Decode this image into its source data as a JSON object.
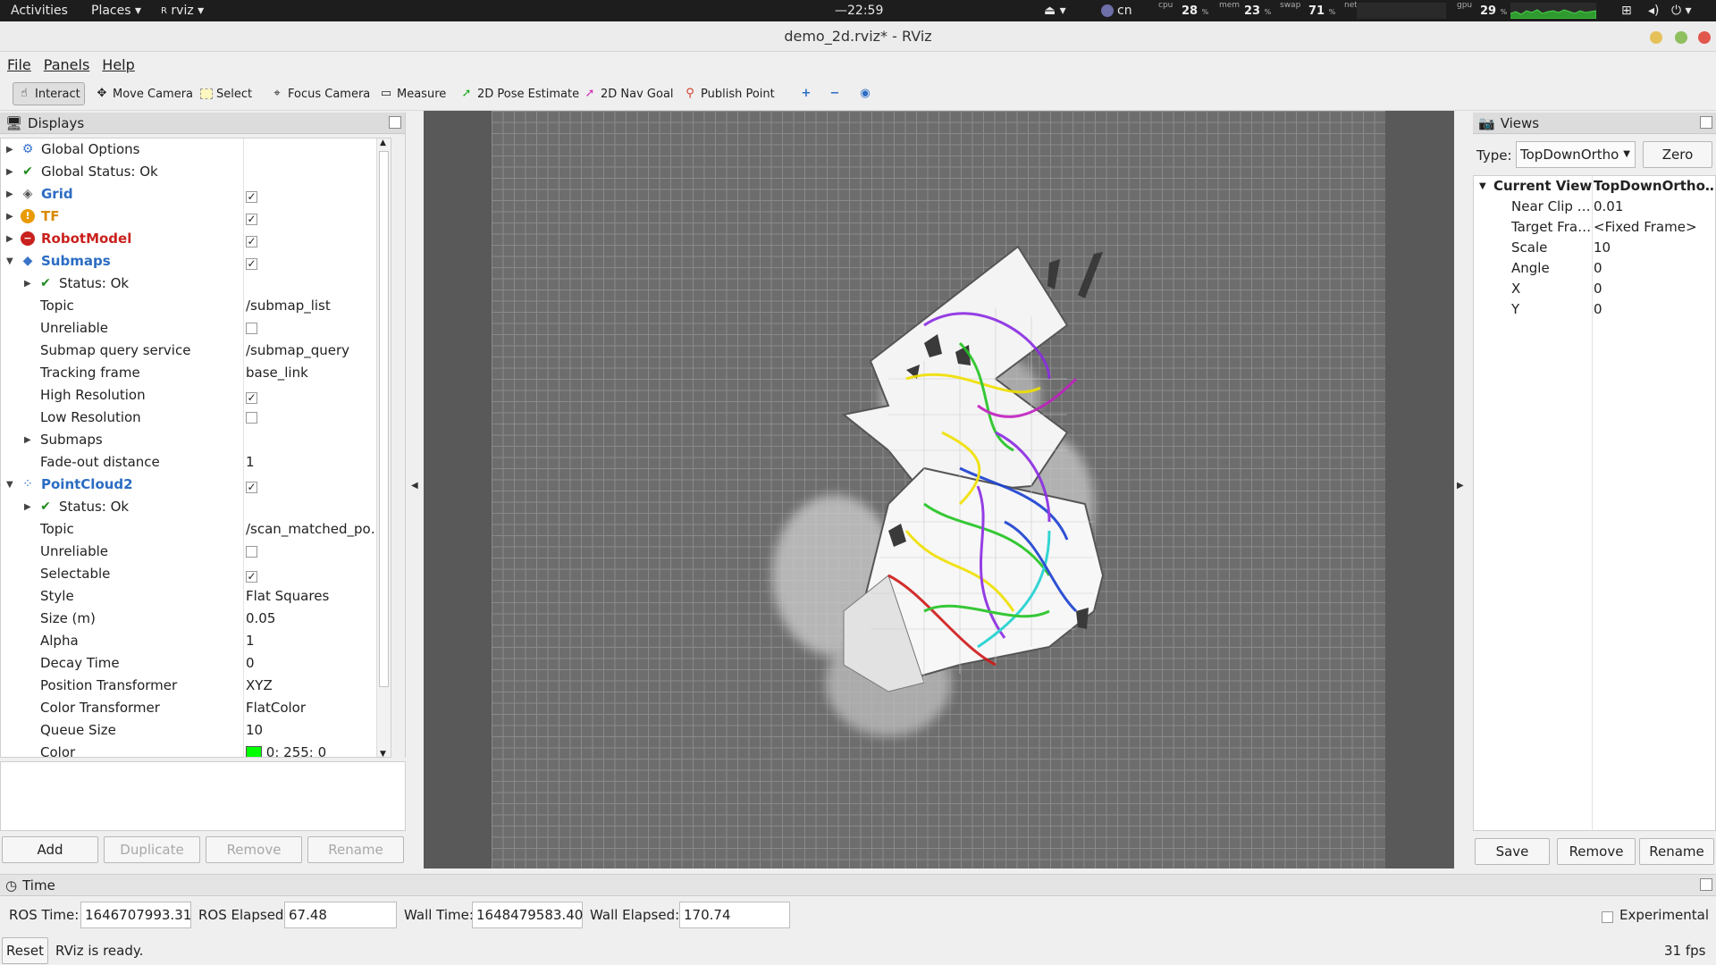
{
  "topbar": {
    "activities": "Activities",
    "places": "Places",
    "app_menu": "rviz",
    "clock": "22:59",
    "keyboard": "cn",
    "cpu_label": "cpu",
    "cpu_value": "28",
    "mem_label": "mem",
    "mem_value": "23",
    "swap_label": "swap",
    "swap_value": "71",
    "net_label": "net",
    "gpu_label": "gpu",
    "gpu_value": "29",
    "pct": "%"
  },
  "window": {
    "title": "demo_2d.rviz* - RViz",
    "close_color": "#e2574c",
    "max_color": "#8fbf5f",
    "min_color": "#e6c15a"
  },
  "menu": {
    "file": "File",
    "panels": "Panels",
    "help": "Help"
  },
  "toolbar": {
    "interact": "Interact",
    "move_camera": "Move Camera",
    "select": "Select",
    "focus_camera": "Focus Camera",
    "measure": "Measure",
    "pose_estimate": "2D Pose Estimate",
    "nav_goal": "2D Nav Goal",
    "publish_point": "Publish Point"
  },
  "displays": {
    "title": "Displays",
    "rows": [
      {
        "label": "Global Options",
        "value": ""
      },
      {
        "label": "Global Status: Ok",
        "value": ""
      },
      {
        "label": "Grid",
        "value": ""
      },
      {
        "label": "TF",
        "value": ""
      },
      {
        "label": "RobotModel",
        "value": ""
      },
      {
        "label": "Submaps",
        "value": ""
      },
      {
        "label": "Status: Ok",
        "value": ""
      },
      {
        "label": "Topic",
        "value": "/submap_list"
      },
      {
        "label": "Unreliable",
        "value": ""
      },
      {
        "label": "Submap query service",
        "value": "/submap_query"
      },
      {
        "label": "Tracking frame",
        "value": "base_link"
      },
      {
        "label": "High Resolution",
        "value": ""
      },
      {
        "label": "Low Resolution",
        "value": ""
      },
      {
        "label": "Submaps",
        "value": ""
      },
      {
        "label": "Fade-out distance",
        "value": "1"
      },
      {
        "label": "PointCloud2",
        "value": ""
      },
      {
        "label": "Status: Ok",
        "value": ""
      },
      {
        "label": "Topic",
        "value": "/scan_matched_poi…"
      },
      {
        "label": "Unreliable",
        "value": ""
      },
      {
        "label": "Selectable",
        "value": ""
      },
      {
        "label": "Style",
        "value": "Flat Squares"
      },
      {
        "label": "Size (m)",
        "value": "0.05"
      },
      {
        "label": "Alpha",
        "value": "1"
      },
      {
        "label": "Decay Time",
        "value": "0"
      },
      {
        "label": "Position Transformer",
        "value": "XYZ"
      },
      {
        "label": "Color Transformer",
        "value": "FlatColor"
      },
      {
        "label": "Queue Size",
        "value": "10"
      },
      {
        "label": "Color",
        "value": "0; 255; 0"
      }
    ],
    "color_swatch": "#00ff00",
    "buttons": {
      "add": "Add",
      "duplicate": "Duplicate",
      "remove": "Remove",
      "rename": "Rename"
    }
  },
  "views": {
    "title": "Views",
    "type_label": "Type:",
    "type_value": "TopDownOrtho",
    "zero": "Zero",
    "current_view": "Current View",
    "current_view_value": "TopDownOrtho…",
    "props": [
      {
        "label": "Near Clip …",
        "value": "0.01"
      },
      {
        "label": "Target Fra…",
        "value": "<Fixed Frame>"
      },
      {
        "label": "Scale",
        "value": "10"
      },
      {
        "label": "Angle",
        "value": "0"
      },
      {
        "label": "X",
        "value": "0"
      },
      {
        "label": "Y",
        "value": "0"
      }
    ],
    "buttons": {
      "save": "Save",
      "remove": "Remove",
      "rename": "Rename"
    }
  },
  "time": {
    "title": "Time",
    "ros_time_label": "ROS Time:",
    "ros_time": "1646707993.31",
    "ros_elapsed_label": "ROS Elapsed:",
    "ros_elapsed": "67.48",
    "wall_time_label": "Wall Time:",
    "wall_time": "1648479583.40",
    "wall_elapsed_label": "Wall Elapsed:",
    "wall_elapsed": "170.74",
    "experimental": "Experimental"
  },
  "status": {
    "reset": "Reset",
    "message": "RViz is ready.",
    "fps": "31 fps"
  },
  "colors": {
    "blue_label": "#2b6cc4",
    "orange_label": "#d98a00",
    "red_label": "#c9211e"
  }
}
